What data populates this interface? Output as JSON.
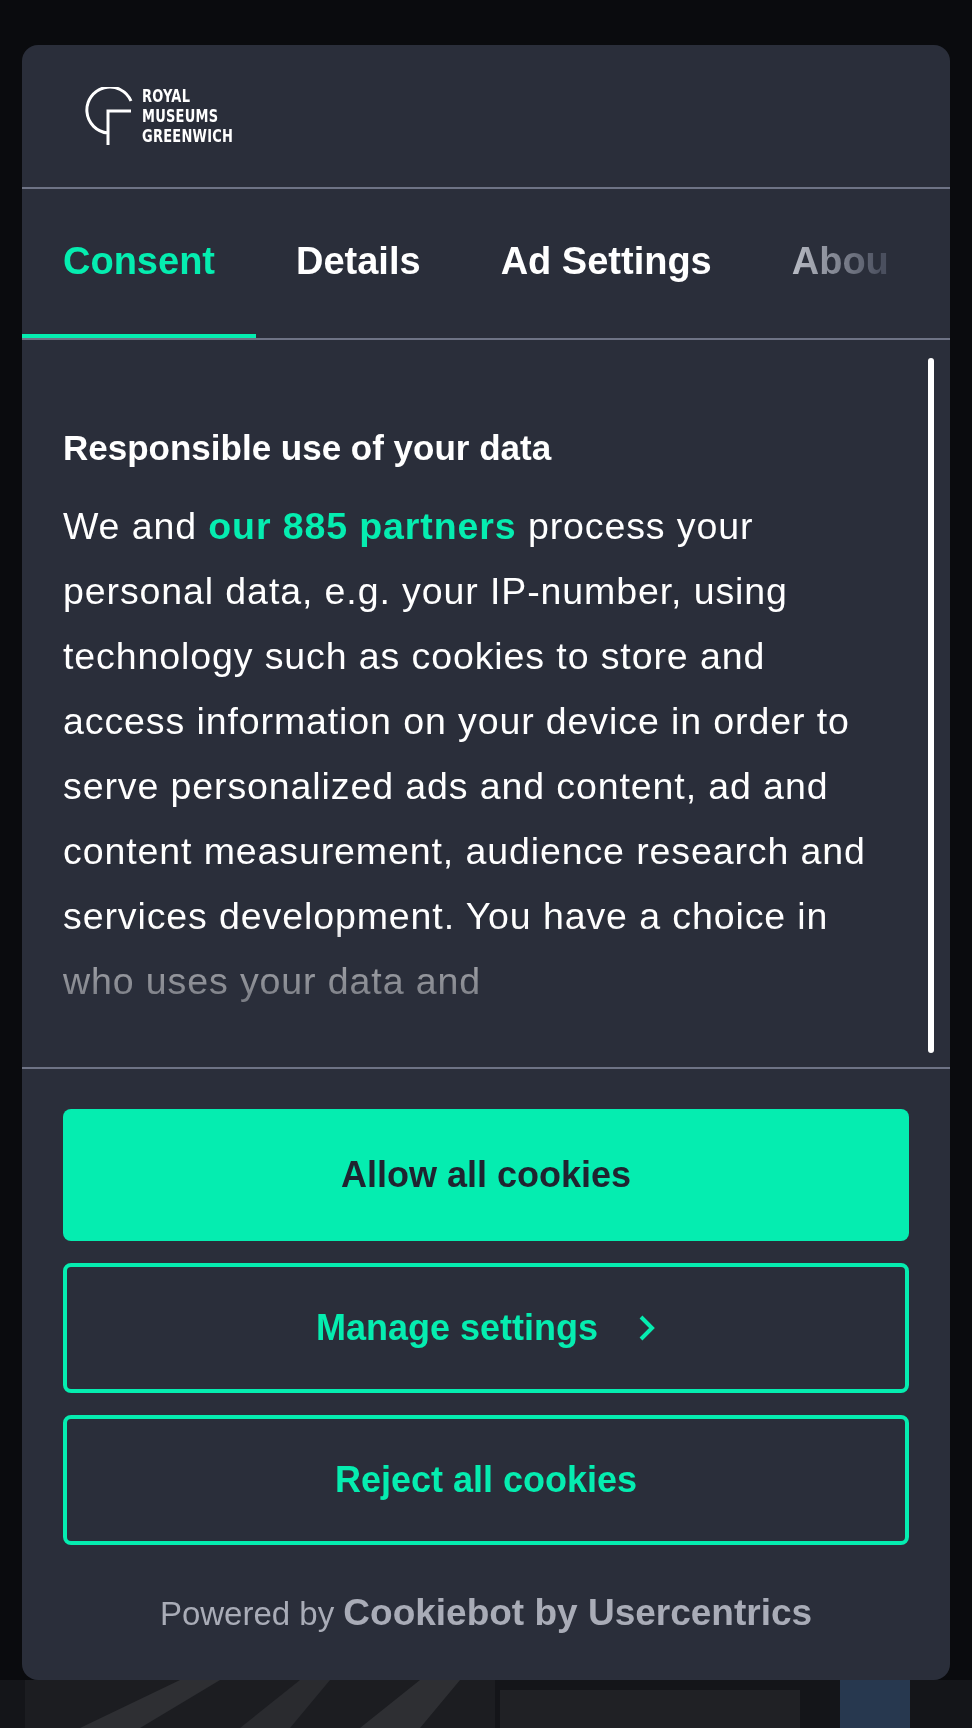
{
  "logo": {
    "lines": [
      "ROYAL",
      "MUSEUMS",
      "GREENWICH"
    ]
  },
  "tabs": [
    {
      "label": "Consent",
      "selected": true
    },
    {
      "label": "Details",
      "selected": false
    },
    {
      "label": "Ad Settings",
      "selected": false
    },
    {
      "label": "Abou",
      "selected": false
    }
  ],
  "content": {
    "heading": "Responsible use of your data",
    "text_before": "We and ",
    "link": "our 885 partners",
    "text_after": " process your personal data, e.g. your IP-number, using technology such as cookies to store and access information on your device in order to serve personalized ads and content, ad and content measurement, audience research and services development. You have a choice in who uses your data and"
  },
  "buttons": [
    {
      "label": "Allow all cookies",
      "kind": "primary",
      "chevron": false
    },
    {
      "label": "Manage settings",
      "kind": "outline",
      "chevron": true
    },
    {
      "label": "Reject all cookies",
      "kind": "outline",
      "chevron": false
    }
  ],
  "footer": "Powered by **Cookiebot by Usercentrics**"
}
